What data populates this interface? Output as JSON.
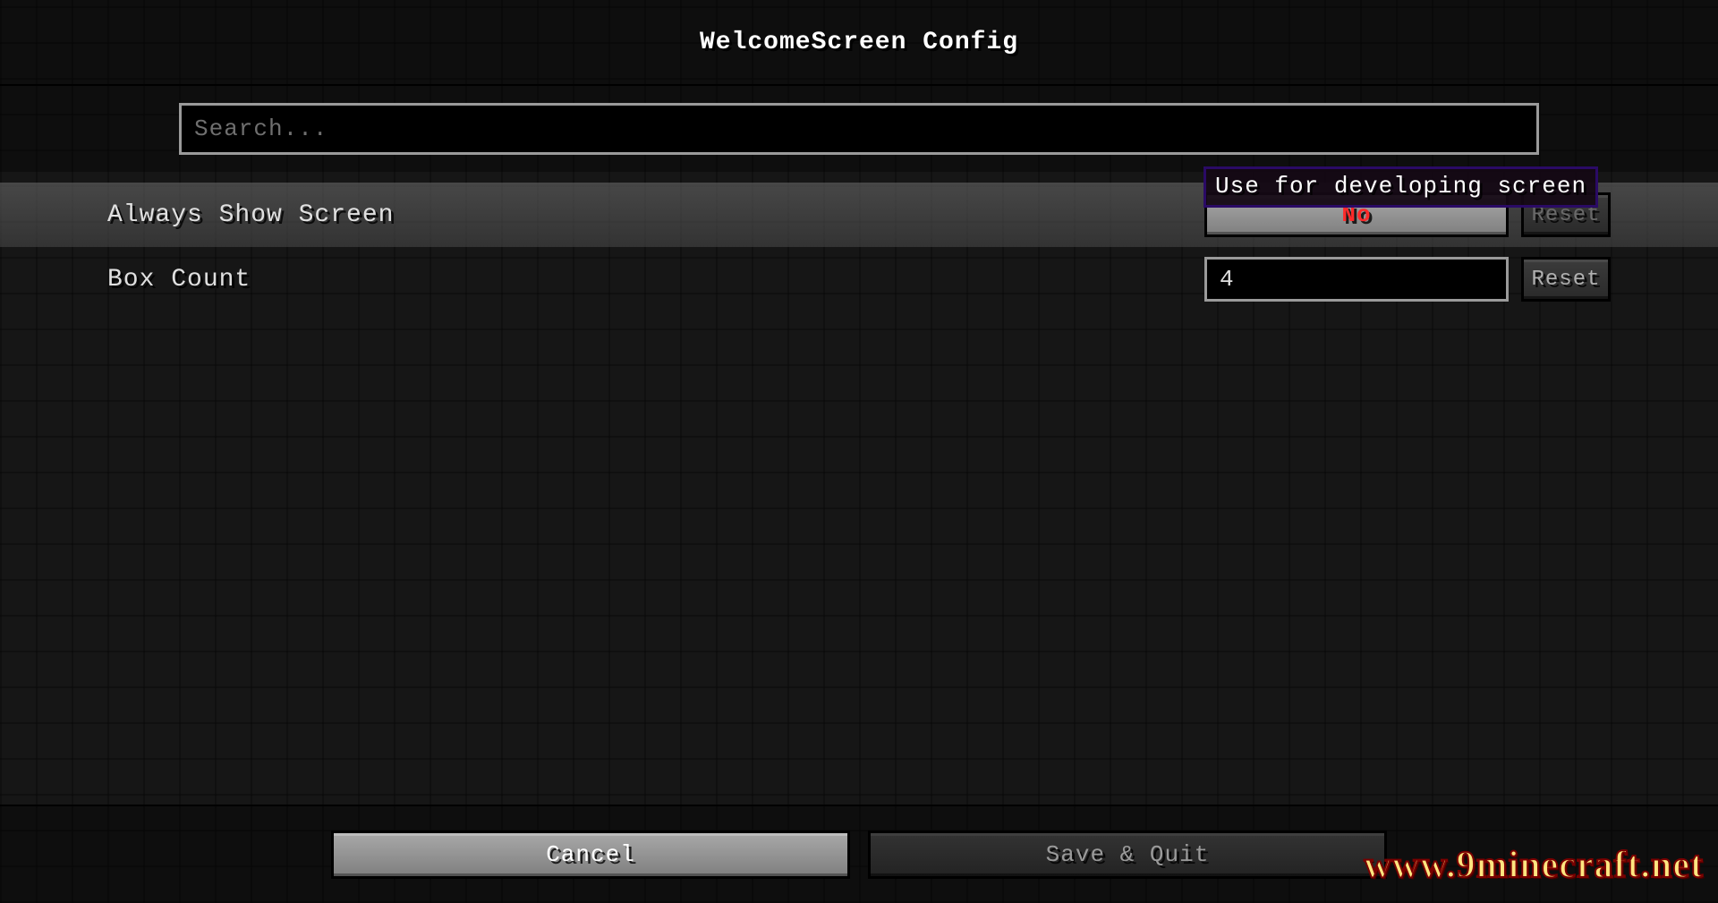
{
  "header": {
    "title": "WelcomeScreen Config"
  },
  "search": {
    "placeholder": "Search..."
  },
  "tooltip": {
    "text": "Use for developing screen"
  },
  "rows": [
    {
      "label": "Always Show Screen",
      "value": "No",
      "reset_label": "Reset"
    },
    {
      "label": "Box Count",
      "value": "4",
      "reset_label": "Reset"
    }
  ],
  "footer": {
    "cancel": "Cancel",
    "save": "Save & Quit"
  },
  "watermark": "www.9minecraft.net"
}
